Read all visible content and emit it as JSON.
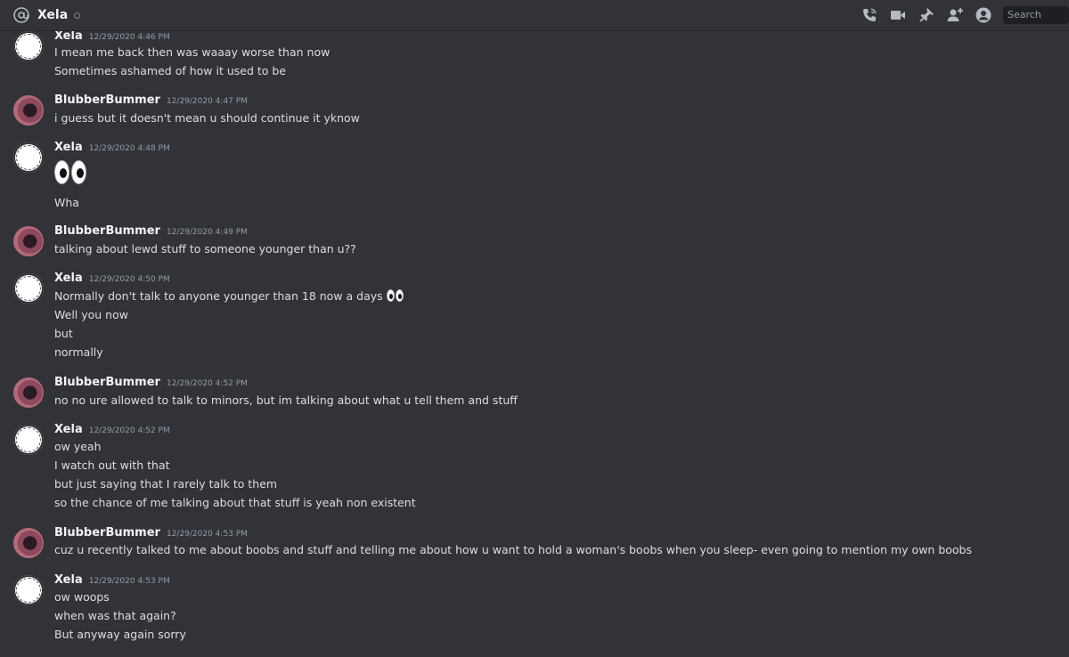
{
  "header": {
    "channel_name": "Xela",
    "search_placeholder": "Search",
    "icons": [
      "at-icon",
      "voice-call-icon",
      "video-call-icon",
      "pin-icon",
      "add-friend-icon",
      "user-profile-icon"
    ]
  },
  "messages": [
    {
      "author": "Xela",
      "timestamp": "12/29/2020 4:46 PM",
      "lines": [
        "I mean me back then was waaay worse than now",
        "Sometimes ashamed of how it used to be"
      ]
    },
    {
      "author": "BlubberBummer",
      "timestamp": "12/29/2020 4:47 PM",
      "lines": [
        "i guess but it doesn't mean u should continue it yknow"
      ]
    },
    {
      "author": "Xela",
      "timestamp": "12/29/2020 4:48 PM",
      "lines": [
        "Wha"
      ]
    },
    {
      "author": "BlubberBummer",
      "timestamp": "12/29/2020 4:49 PM",
      "lines": [
        "talking about lewd stuff to someone younger than u??"
      ]
    },
    {
      "author": "Xela",
      "timestamp": "12/29/2020 4:50 PM",
      "lines": [
        "Normally don't talk to anyone younger than 18 now a days",
        "Well you now",
        "but",
        "normally"
      ]
    },
    {
      "author": "BlubberBummer",
      "timestamp": "12/29/2020 4:52 PM",
      "lines": [
        "no no ure allowed to talk to minors, but im talking about what u tell them and stuff"
      ]
    },
    {
      "author": "Xela",
      "timestamp": "12/29/2020 4:52 PM",
      "lines": [
        "ow yeah",
        "I watch out with that",
        "but just saying that I rarely talk to them",
        "so the chance of me talking about that stuff is yeah non existent"
      ]
    },
    {
      "author": "BlubberBummer",
      "timestamp": "12/29/2020 4:53 PM",
      "lines": [
        "cuz u recently talked to me about boobs and stuff and telling me about how u want to hold a woman's boobs when you sleep- even going to mention my own boobs"
      ]
    },
    {
      "author": "Xela",
      "timestamp": "12/29/2020 4:53 PM",
      "lines": [
        "ow woops",
        "when was that again?",
        "But anyway again sorry"
      ]
    }
  ]
}
